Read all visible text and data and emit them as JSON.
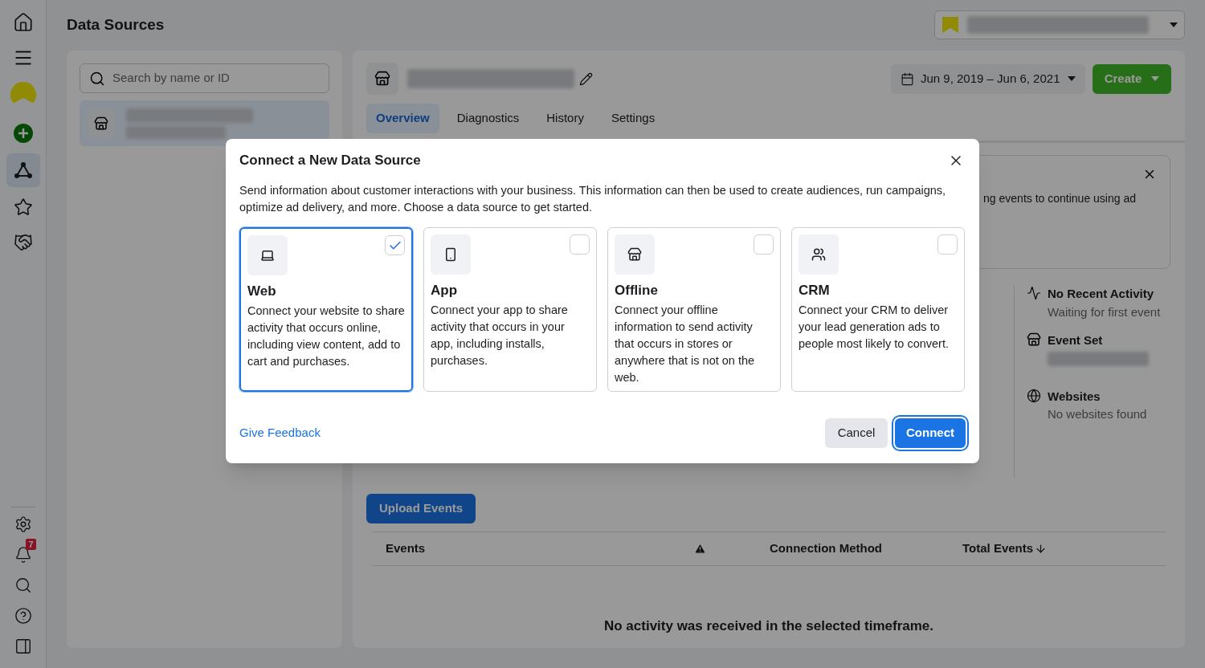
{
  "sidebar": {
    "items": [
      {
        "selected": false
      },
      {
        "selected": false
      },
      {
        "selected": false
      },
      {
        "selected": true
      },
      {
        "selected": false
      },
      {
        "selected": false
      }
    ],
    "notification_count": "7"
  },
  "header": {
    "title": "Data Sources"
  },
  "source_list": {
    "search": {
      "placeholder": "Search by name or ID"
    },
    "items": [
      {
        "selected": true
      }
    ]
  },
  "detail": {
    "date_range": "Jun 9, 2019 – Jun 6, 2021",
    "create_label": "Create",
    "tabs": [
      {
        "label": "Overview",
        "selected": true
      },
      {
        "label": "Diagnostics",
        "selected": false
      },
      {
        "label": "History",
        "selected": false
      },
      {
        "label": "Settings",
        "selected": false
      }
    ],
    "banner": {
      "text": "ng events to continue using ad"
    },
    "summary": [
      {
        "kind": "activity",
        "title": "No Recent Activity",
        "subtitle": "Waiting for first event"
      },
      {
        "kind": "event_set",
        "title": "Event Set"
      },
      {
        "kind": "websites",
        "title": "Websites",
        "subtitle": "No websites found"
      }
    ],
    "upload_label": "Upload Events",
    "table": {
      "columns": [
        {
          "kind": "text",
          "label": "Events"
        },
        {
          "kind": "warning"
        },
        {
          "kind": "text",
          "label": "Connection Method"
        },
        {
          "kind": "sorted",
          "label": "Total Events"
        }
      ],
      "empty_text": "No activity was received in the selected timeframe."
    }
  },
  "dialog": {
    "title": "Connect a New Data Source",
    "description": "Send information about customer interactions with your business. This information can then be used to create audiences, run campaigns, optimize ad delivery, and more. Choose a data source to get started.",
    "options": [
      {
        "kind": "web",
        "title": "Web",
        "description": "Connect your website to share activity that occurs online, including view content, add to cart and purchases.",
        "selected": true
      },
      {
        "kind": "app",
        "title": "App",
        "description": "Connect your app to share activity that occurs in your app, including installs, purchases.",
        "selected": false
      },
      {
        "kind": "offline",
        "title": "Offline",
        "description": "Connect your offline information to send activity that occurs in stores or anywhere that is not on the web.",
        "selected": false
      },
      {
        "kind": "crm",
        "title": "CRM",
        "description": "Connect your CRM to deliver your lead generation ads to people most likely to convert.",
        "selected": false
      }
    ],
    "feedback_link": "Give Feedback",
    "cancel_label": "Cancel",
    "connect_label": "Connect"
  }
}
